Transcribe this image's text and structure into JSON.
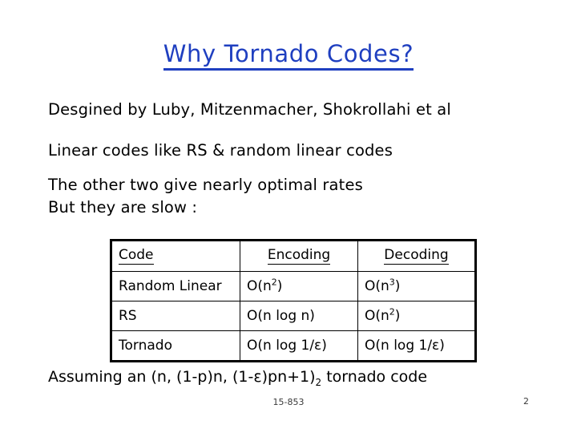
{
  "slide": {
    "title": "Why Tornado Codes?",
    "title_color": "#1f3fc0",
    "background_color": "#ffffff",
    "text_color": "#000000"
  },
  "body": {
    "lines": [
      "Desgined by Luby, Mitzenmacher, Shokrollahi et al",
      "Linear codes like RS & random linear codes",
      "The other two give nearly optimal rates",
      "But they are slow :"
    ]
  },
  "table": {
    "headers": {
      "code": "Code",
      "encoding": "Encoding",
      "decoding": "Decoding"
    },
    "rows": [
      {
        "code": "Random Linear",
        "encoding": {
          "base": "O(n",
          "sup": "2",
          "tail": ")"
        },
        "decoding": {
          "base": "O(n",
          "sup": "3",
          "tail": ")"
        }
      },
      {
        "code": "RS",
        "encoding": {
          "base": "O(n log n)",
          "sup": "",
          "tail": ""
        },
        "decoding": {
          "base": "O(n",
          "sup": "2",
          "tail": ")"
        }
      },
      {
        "code": "Tornado",
        "encoding": {
          "base": "O(n log 1/ε)",
          "sup": "",
          "tail": ""
        },
        "decoding": {
          "base": "O(n log 1/ε)",
          "sup": "",
          "tail": ""
        }
      }
    ]
  },
  "caption": {
    "before": "Assuming an (n, (1-p)n, (1-ε)pn+1)",
    "sub": "2",
    "after": " tornado code"
  },
  "footer": {
    "course": "15-853",
    "page_number": "2"
  }
}
